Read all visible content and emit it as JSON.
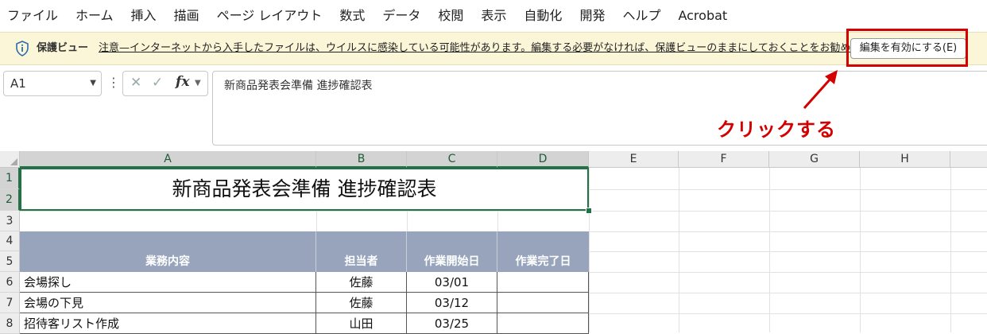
{
  "menu": [
    "ファイル",
    "ホーム",
    "挿入",
    "描画",
    "ページ レイアウト",
    "数式",
    "データ",
    "校閲",
    "表示",
    "自動化",
    "開発",
    "ヘルプ",
    "Acrobat"
  ],
  "protected_view": {
    "title": "保護ビュー",
    "message": "注意—インターネットから入手したファイルは、ウイルスに感染している可能性があります。編集する必要がなければ、保護ビューのままにしておくことをお勧めします。",
    "enable_button": "編集を有効にする(E)"
  },
  "formula_bar": {
    "name_box": "A1",
    "fx": "fx",
    "content": "新商品発表会準備 進捗確認表"
  },
  "annotation": "クリックする",
  "sheet": {
    "columns": [
      "A",
      "B",
      "C",
      "D",
      "E",
      "F",
      "G",
      "H"
    ],
    "rows": [
      "1",
      "2",
      "3",
      "4",
      "5",
      "6",
      "7",
      "8"
    ],
    "title": "新商品発表会準備 進捗確認表",
    "headers": [
      "業務内容",
      "担当者",
      "作業開始日",
      "作業完了日"
    ],
    "data": [
      [
        "会場探し",
        "佐藤",
        "03/01",
        ""
      ],
      [
        "会場の下見",
        "佐藤",
        "03/12",
        ""
      ],
      [
        "招待客リスト作成",
        "山田",
        "03/25",
        ""
      ]
    ]
  },
  "colors": {
    "accent": "#217346",
    "header_fill": "#97a4bb",
    "protected_bar": "#fcf6d9",
    "annotation": "#d40000"
  }
}
